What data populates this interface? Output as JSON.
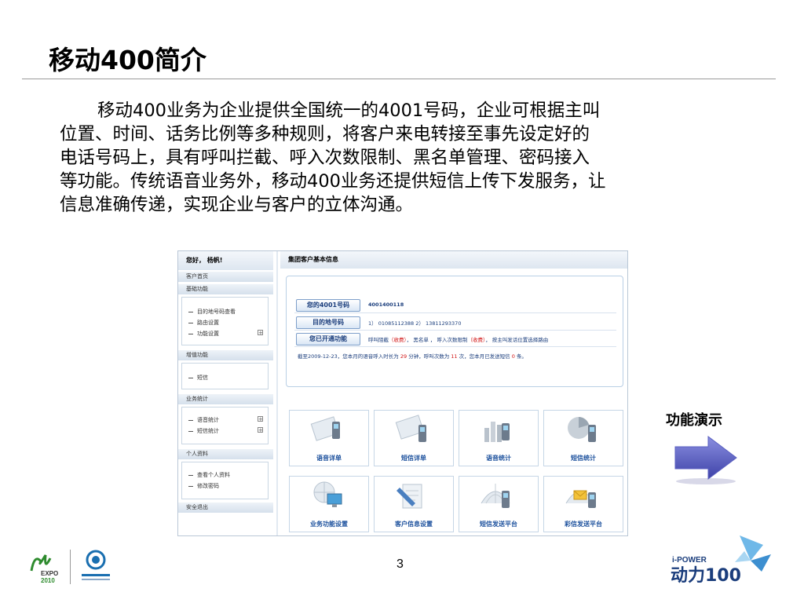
{
  "slide": {
    "title": "移动400简介",
    "body_lines": [
      "移动400业务为企业提供全国统一的4001号码，企业可根据主叫",
      "位置、时间、话务比例等多种规则，将客户来电转接至事先设定好的",
      "电话号码上，具有呼叫拦截、呼入次数限制、黑名单管理、密码接入",
      "等功能。传统语音业务外，移动400业务还提供短信上传下发服务，让",
      "信息准确传递，实现企业与客户的立体沟通。"
    ],
    "demo_label": "功能演示",
    "page_number": "3"
  },
  "app": {
    "sidebar": {
      "greeting": "您好， 杨帆!",
      "home": "客户首页",
      "sections": [
        {
          "title": "基础功能",
          "items": [
            "目的地号码查看",
            "路由设置",
            "功能设置"
          ]
        },
        {
          "title": "增值功能",
          "items": [
            "短信"
          ]
        },
        {
          "title": "业务统计",
          "items": [
            "语音统计",
            "短信统计"
          ]
        },
        {
          "title": "个人资料",
          "items": [
            "查看个人资料",
            "修改密码"
          ]
        }
      ],
      "logout": "安全退出"
    },
    "main": {
      "header": "集团客户基本信息",
      "number_label": "您的4001号码",
      "number_value": "4001400118",
      "dest_label": "目的地号码",
      "dest_value": "1） 01085112388    2） 13811293370",
      "features_label": "您已开通功能",
      "feat_1": "呼叫阻截",
      "feat_fee": "（收费）",
      "feat_2": "，  黑名单  ，  呼入次数限制",
      "feat_3": "，  按主叫发话位置选择路由",
      "note_1": "截至2009-12-23，您本月的语音呼入时长为",
      "note_minutes": "29",
      "note_2": "分钟，呼叫次数为",
      "note_calls": "11",
      "note_3": "次，您本月已发送短信",
      "note_sms": "0",
      "note_4": "条。"
    },
    "tiles": [
      "语音详单",
      "短信详单",
      "语音统计",
      "短信统计",
      "业务功能设置",
      "客户信息设置",
      "短信发送平台",
      "彩信发送平台"
    ]
  },
  "logos": {
    "expo_text": "EXPO",
    "expo_year": "2010",
    "right_top": "i-POWER",
    "right_main": "动力100"
  }
}
